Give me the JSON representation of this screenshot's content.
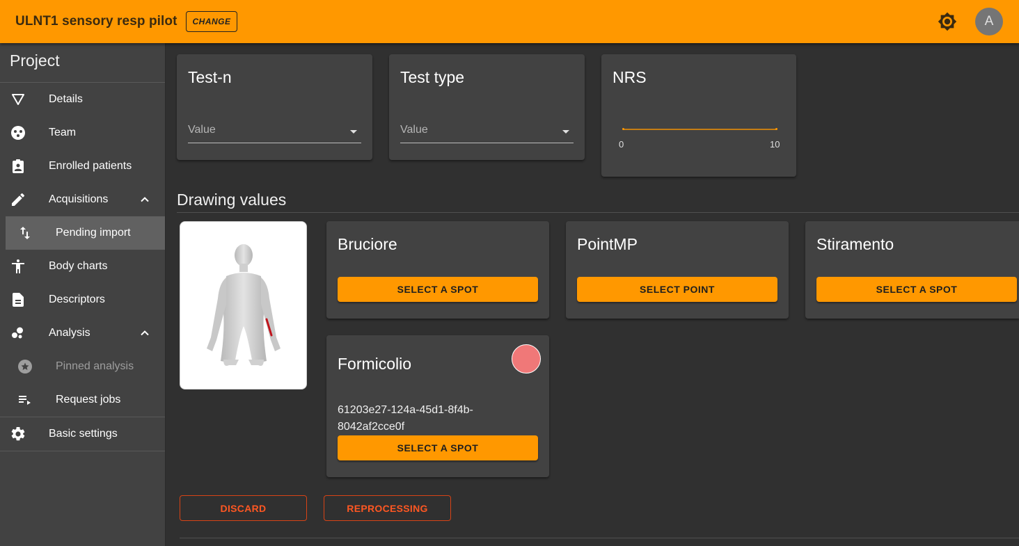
{
  "topbar": {
    "project_name": "ULNT1 sensory resp pilot",
    "change_label": "CHANGE",
    "avatar_initial": "A",
    "color": "#ff9800"
  },
  "sidebar": {
    "header": "Project",
    "items": [
      {
        "label": "Details",
        "icon": "filter-triangle-icon"
      },
      {
        "label": "Team",
        "icon": "team-icon"
      },
      {
        "label": "Enrolled patients",
        "icon": "clipboard-account-icon"
      },
      {
        "label": "Acquisitions",
        "icon": "pencil-icon",
        "expanded": true
      },
      {
        "label": "Pending import",
        "icon": "swap-vertical-icon",
        "active": true
      },
      {
        "label": "Body charts",
        "icon": "accessibility-icon"
      },
      {
        "label": "Descriptors",
        "icon": "document-icon"
      },
      {
        "label": "Analysis",
        "icon": "bubble-chart-icon",
        "expanded": true
      },
      {
        "label": "Pinned analysis",
        "icon": "star-circle-icon",
        "disabled": true
      },
      {
        "label": "Request jobs",
        "icon": "playlist-icon"
      },
      {
        "label": "Basic settings",
        "icon": "gear-icon"
      }
    ]
  },
  "fields": {
    "test_n": {
      "title": "Test-n",
      "placeholder": "Value"
    },
    "test_type": {
      "title": "Test type",
      "placeholder": "Value"
    },
    "nrs": {
      "title": "NRS",
      "min_label": "0",
      "max_label": "10"
    }
  },
  "drawing": {
    "section_title": "Drawing values",
    "cards": [
      {
        "title": "Bruciore",
        "button": "SELECT A SPOT"
      },
      {
        "title": "PointMP",
        "button": "SELECT POINT"
      },
      {
        "title": "Stiramento",
        "button": "SELECT A SPOT"
      },
      {
        "title": "Formicolio",
        "id_text": "61203e27-124a-45d1-8f4b-8042af2cce0f",
        "button": "SELECT A SPOT",
        "dot_color": "#f07878"
      }
    ]
  },
  "actions": {
    "discard": "DISCARD",
    "reprocessing": "REPROCESSING"
  }
}
